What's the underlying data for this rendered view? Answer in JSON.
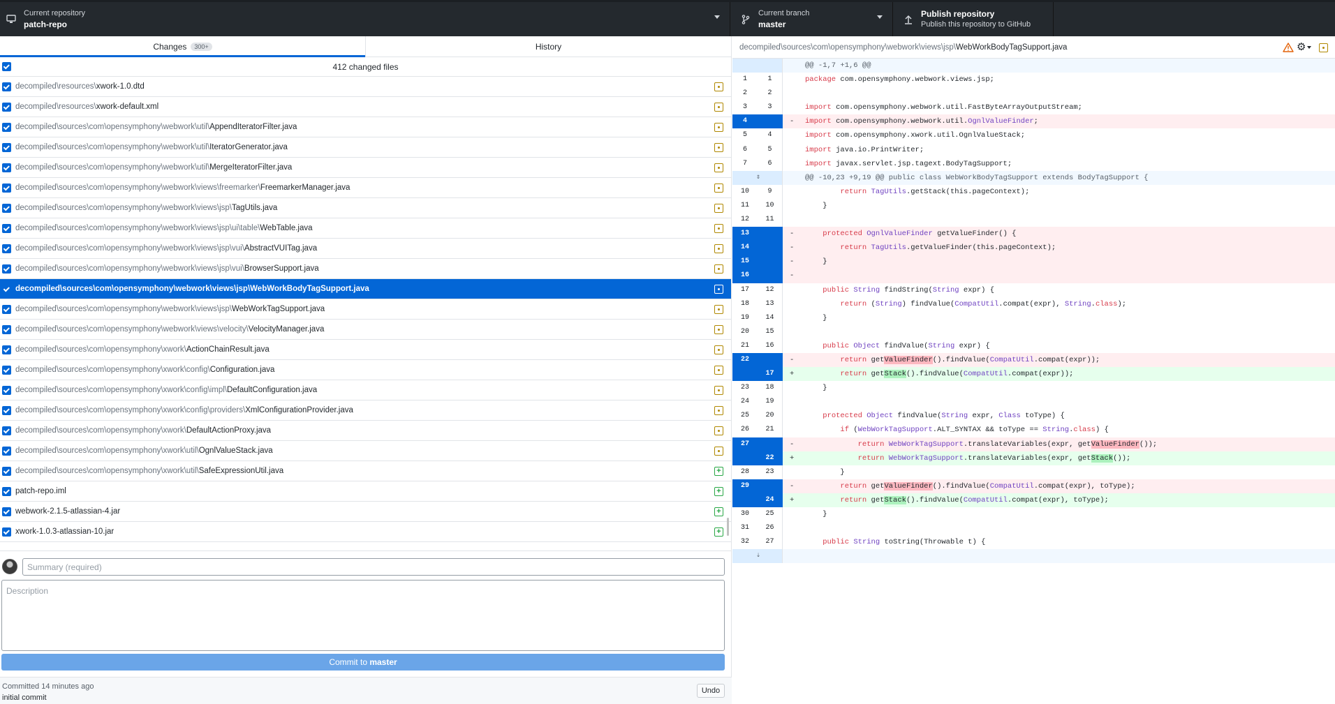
{
  "toolbar": {
    "repo": {
      "sub": "Current repository",
      "main": "patch-repo"
    },
    "branch": {
      "sub": "Current branch",
      "main": "master"
    },
    "publish": {
      "main": "Publish repository",
      "sub": "Publish this repository to GitHub"
    }
  },
  "tabs": {
    "changes": "Changes",
    "changes_badge": "300+",
    "history": "History"
  },
  "changes_header": "412 changed files",
  "files": [
    {
      "dir": "decompiled\\resources\\",
      "name": "xwork-1.0.dtd",
      "status": "modified"
    },
    {
      "dir": "decompiled\\resources\\",
      "name": "xwork-default.xml",
      "status": "modified"
    },
    {
      "dir": "decompiled\\sources\\com\\opensymphony\\webwork\\util\\",
      "name": "AppendIteratorFilter.java",
      "status": "modified"
    },
    {
      "dir": "decompiled\\sources\\com\\opensymphony\\webwork\\util\\",
      "name": "IteratorGenerator.java",
      "status": "modified"
    },
    {
      "dir": "decompiled\\sources\\com\\opensymphony\\webwork\\util\\",
      "name": "MergeIteratorFilter.java",
      "status": "modified"
    },
    {
      "dir": "decompiled\\sources\\com\\opensymphony\\webwork\\views\\freemarker\\",
      "name": "FreemarkerManager.java",
      "status": "modified"
    },
    {
      "dir": "decompiled\\sources\\com\\opensymphony\\webwork\\views\\jsp\\",
      "name": "TagUtils.java",
      "status": "modified"
    },
    {
      "dir": "decompiled\\sources\\com\\opensymphony\\webwork\\views\\jsp\\ui\\table\\",
      "name": "WebTable.java",
      "status": "modified"
    },
    {
      "dir": "decompiled\\sources\\com\\opensymphony\\webwork\\views\\jsp\\vui\\",
      "name": "AbstractVUITag.java",
      "status": "modified"
    },
    {
      "dir": "decompiled\\sources\\com\\opensymphony\\webwork\\views\\jsp\\vui\\",
      "name": "BrowserSupport.java",
      "status": "modified"
    },
    {
      "dir": "decompiled\\sources\\com\\opensymphony\\webwork\\views\\jsp\\",
      "name": "WebWorkBodyTagSupport.java",
      "status": "modified",
      "selected": true
    },
    {
      "dir": "decompiled\\sources\\com\\opensymphony\\webwork\\views\\jsp\\",
      "name": "WebWorkTagSupport.java",
      "status": "modified"
    },
    {
      "dir": "decompiled\\sources\\com\\opensymphony\\webwork\\views\\velocity\\",
      "name": "VelocityManager.java",
      "status": "modified"
    },
    {
      "dir": "decompiled\\sources\\com\\opensymphony\\xwork\\",
      "name": "ActionChainResult.java",
      "status": "modified"
    },
    {
      "dir": "decompiled\\sources\\com\\opensymphony\\xwork\\config\\",
      "name": "Configuration.java",
      "status": "modified"
    },
    {
      "dir": "decompiled\\sources\\com\\opensymphony\\xwork\\config\\impl\\",
      "name": "DefaultConfiguration.java",
      "status": "modified"
    },
    {
      "dir": "decompiled\\sources\\com\\opensymphony\\xwork\\config\\providers\\",
      "name": "XmlConfigurationProvider.java",
      "status": "modified"
    },
    {
      "dir": "decompiled\\sources\\com\\opensymphony\\xwork\\",
      "name": "DefaultActionProxy.java",
      "status": "modified"
    },
    {
      "dir": "decompiled\\sources\\com\\opensymphony\\xwork\\util\\",
      "name": "OgnlValueStack.java",
      "status": "modified"
    },
    {
      "dir": "decompiled\\sources\\com\\opensymphony\\xwork\\util\\",
      "name": "SafeExpressionUtil.java",
      "status": "added"
    },
    {
      "dir": "",
      "name": "patch-repo.iml",
      "status": "added"
    },
    {
      "dir": "",
      "name": "webwork-2.1.5-atlassian-4.jar",
      "status": "added"
    },
    {
      "dir": "",
      "name": "xwork-1.0.3-atlassian-10.jar",
      "status": "added"
    }
  ],
  "commit": {
    "summary_placeholder": "Summary (required)",
    "description_placeholder": "Description",
    "button_prefix": "Commit to ",
    "button_branch": "master"
  },
  "last_commit": {
    "time": "Committed 14 minutes ago",
    "message": "initial commit",
    "undo": "Undo"
  },
  "diff": {
    "path_dir": "decompiled\\sources\\com\\opensymphony\\webwork\\views\\jsp\\",
    "path_name": "WebWorkBodyTagSupport.java",
    "lines": [
      {
        "t": "hunk",
        "o": "",
        "n": "",
        "code": "@@ -1,7 +1,6 @@"
      },
      {
        "t": "ctx",
        "o": "1",
        "n": "1",
        "code": "package com.opensymphony.webwork.views.jsp;"
      },
      {
        "t": "ctx",
        "o": "2",
        "n": "2",
        "code": ""
      },
      {
        "t": "ctx",
        "o": "3",
        "n": "3",
        "code": "import com.opensymphony.webwork.util.FastByteArrayOutputStream;"
      },
      {
        "t": "del",
        "o": "4",
        "n": "",
        "code": "import com.opensymphony.webwork.util.OgnlValueFinder;"
      },
      {
        "t": "ctx",
        "o": "5",
        "n": "4",
        "code": "import com.opensymphony.xwork.util.OgnlValueStack;"
      },
      {
        "t": "ctx",
        "o": "6",
        "n": "5",
        "code": "import java.io.PrintWriter;"
      },
      {
        "t": "ctx",
        "o": "7",
        "n": "6",
        "code": "import javax.servlet.jsp.tagext.BodyTagSupport;"
      },
      {
        "t": "hunk",
        "o": "",
        "n": "",
        "code": "@@ -10,23 +9,19 @@ public class WebWorkBodyTagSupport extends BodyTagSupport {",
        "expand": "both"
      },
      {
        "t": "ctx",
        "o": "10",
        "n": "9",
        "code": "        return TagUtils.getStack(this.pageContext);"
      },
      {
        "t": "ctx",
        "o": "11",
        "n": "10",
        "code": "    }"
      },
      {
        "t": "ctx",
        "o": "12",
        "n": "11",
        "code": ""
      },
      {
        "t": "del",
        "o": "13",
        "n": "",
        "code": "    protected OgnlValueFinder getValueFinder() {"
      },
      {
        "t": "del",
        "o": "14",
        "n": "",
        "code": "        return TagUtils.getValueFinder(this.pageContext);"
      },
      {
        "t": "del",
        "o": "15",
        "n": "",
        "code": "    }"
      },
      {
        "t": "del",
        "o": "16",
        "n": "",
        "code": ""
      },
      {
        "t": "ctx",
        "o": "17",
        "n": "12",
        "code": "    public String findString(String expr) {"
      },
      {
        "t": "ctx",
        "o": "18",
        "n": "13",
        "code": "        return (String) findValue(CompatUtil.compat(expr), String.class);"
      },
      {
        "t": "ctx",
        "o": "19",
        "n": "14",
        "code": "    }"
      },
      {
        "t": "ctx",
        "o": "20",
        "n": "15",
        "code": ""
      },
      {
        "t": "ctx",
        "o": "21",
        "n": "16",
        "code": "    public Object findValue(String expr) {"
      },
      {
        "t": "del",
        "o": "22",
        "n": "",
        "code": "        return getValueFinder().findValue(CompatUtil.compat(expr));",
        "hl": "ValueFinder"
      },
      {
        "t": "add",
        "o": "",
        "n": "17",
        "code": "        return getStack().findValue(CompatUtil.compat(expr));",
        "hl": "Stack"
      },
      {
        "t": "ctx",
        "o": "23",
        "n": "18",
        "code": "    }"
      },
      {
        "t": "ctx",
        "o": "24",
        "n": "19",
        "code": ""
      },
      {
        "t": "ctx",
        "o": "25",
        "n": "20",
        "code": "    protected Object findValue(String expr, Class toType) {"
      },
      {
        "t": "ctx",
        "o": "26",
        "n": "21",
        "code": "        if (WebWorkTagSupport.ALT_SYNTAX && toType == String.class) {"
      },
      {
        "t": "del",
        "o": "27",
        "n": "",
        "code": "            return WebWorkTagSupport.translateVariables(expr, getValueFinder());",
        "hl": "ValueFinder"
      },
      {
        "t": "add",
        "o": "",
        "n": "22",
        "code": "            return WebWorkTagSupport.translateVariables(expr, getStack());",
        "hl": "Stack"
      },
      {
        "t": "ctx",
        "o": "28",
        "n": "23",
        "code": "        }"
      },
      {
        "t": "del",
        "o": "29",
        "n": "",
        "code": "        return getValueFinder().findValue(CompatUtil.compat(expr), toType);",
        "hl": "ValueFinder"
      },
      {
        "t": "add",
        "o": "",
        "n": "24",
        "code": "        return getStack().findValue(CompatUtil.compat(expr), toType);",
        "hl": "Stack"
      },
      {
        "t": "ctx",
        "o": "30",
        "n": "25",
        "code": "    }"
      },
      {
        "t": "ctx",
        "o": "31",
        "n": "26",
        "code": ""
      },
      {
        "t": "ctx",
        "o": "32",
        "n": "27",
        "code": "    public String toString(Throwable t) {"
      },
      {
        "t": "hunk",
        "o": "",
        "n": "",
        "code": "",
        "expand": "down"
      }
    ]
  }
}
